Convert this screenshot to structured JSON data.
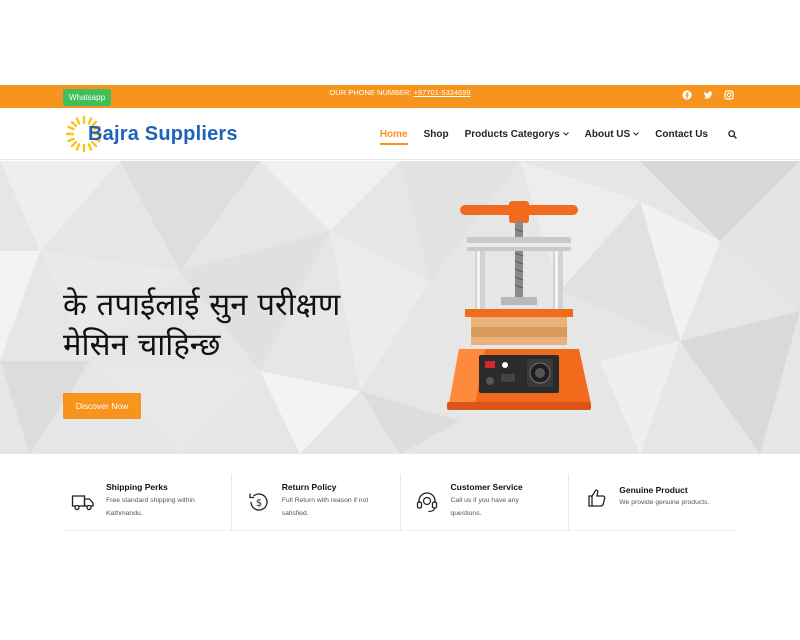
{
  "topbar": {
    "whatsapp_label": "Whatsapp",
    "phone_label": "OUR PHONE NUMBER: ",
    "phone_number": "+97701-5324699",
    "socials": [
      "facebook-icon",
      "twitter-icon",
      "instagram-icon"
    ]
  },
  "brand": {
    "name": "Bajra Suppliers",
    "color": "#1e63b8",
    "accent": "#f7941d"
  },
  "nav": {
    "home": "Home",
    "shop": "Shop",
    "products": "Products Categorys",
    "about": "About US",
    "contact": "Contact Us"
  },
  "hero": {
    "title": "के तपाईलाई सुन परीक्षण\nमेसिन चाहिन्छ",
    "cta": "Discover Now"
  },
  "features": [
    {
      "icon": "truck-icon",
      "title": "Shipping Perks",
      "desc": "Free standard shipping within Kathmandu."
    },
    {
      "icon": "dollar-return-icon",
      "title": "Return Policy",
      "desc": "Full Return with reason if not satisfied."
    },
    {
      "icon": "headset-icon",
      "title": "Customer Service",
      "desc": "Call us if you have any questions."
    },
    {
      "icon": "thumbs-up-icon",
      "title": "Genuine Product",
      "desc": "We provide genuine products."
    }
  ]
}
